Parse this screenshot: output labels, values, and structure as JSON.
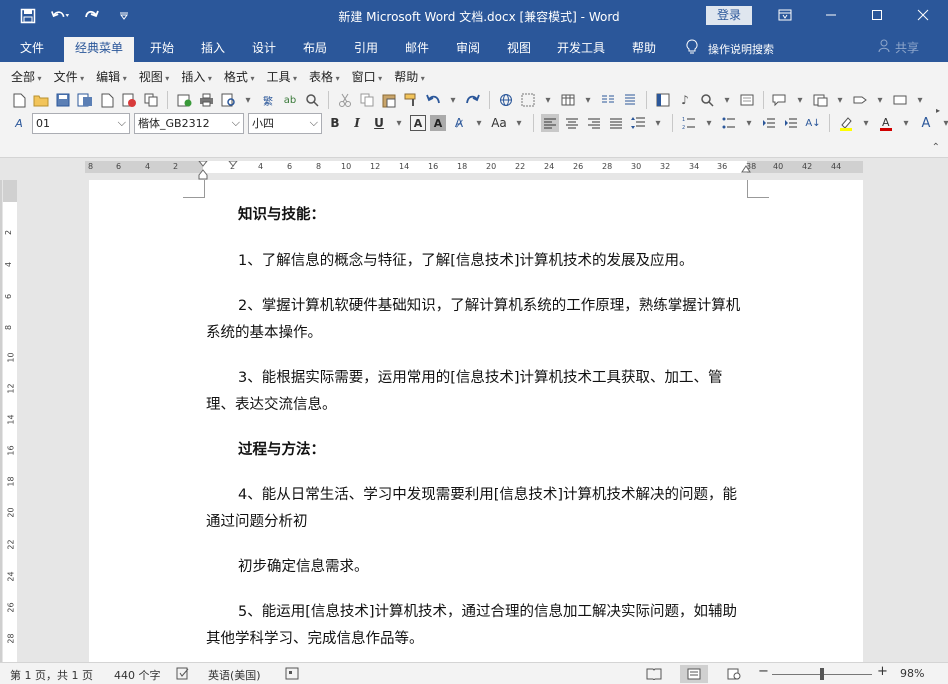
{
  "titlebar": {
    "title": "新建 Microsoft Word 文档.docx [兼容模式]  -  Word",
    "login": "登录",
    "qat_icons": [
      "save-icon",
      "undo-icon",
      "redo-icon",
      "customize-icon"
    ],
    "color": "#2b579a"
  },
  "tabs": [
    "文件",
    "经典菜单",
    "开始",
    "插入",
    "设计",
    "布局",
    "引用",
    "邮件",
    "审阅",
    "视图",
    "开发工具",
    "帮助"
  ],
  "active_tab": "经典菜单",
  "tellme": "操作说明搜索",
  "share": "共享",
  "menus": [
    "全部",
    "文件",
    "编辑",
    "视图",
    "插入",
    "格式",
    "工具",
    "表格",
    "窗口",
    "帮助"
  ],
  "format": {
    "style": "01",
    "font": "楷体_GB2312",
    "size": "小四",
    "bold": "B",
    "italic": "I",
    "underline": "U",
    "char_border": "A",
    "char_shading": "A",
    "case": "Aa"
  },
  "ruler": {
    "left_ticks": [
      "8",
      "6",
      "4",
      "2"
    ],
    "right_ticks": [
      "2",
      "4",
      "6",
      "8",
      "10",
      "12",
      "14",
      "16",
      "18",
      "20",
      "22",
      "24",
      "26",
      "28",
      "30",
      "32",
      "34",
      "36",
      "38",
      "40",
      "42",
      "44"
    ],
    "vertical_ticks": [
      "2",
      "4",
      "6",
      "8",
      "10",
      "12",
      "14",
      "16",
      "18",
      "20",
      "22",
      "24",
      "26",
      "28"
    ]
  },
  "document": {
    "heading1": "知识与技能：",
    "p1": "1、了解信息的概念与特征，了解[信息技术]计算机技术的发展及应用。",
    "p2": "2、掌握计算机软硬件基础知识，了解计算机系统的工作原理，熟练掌握计算机系统的基本操作。",
    "p3": "3、能根据实际需要，运用常用的[信息技术]计算机技术工具获取、加工、管理、表达交流信息。",
    "heading2": "过程与方法：",
    "p4": "4、能从日常生活、学习中发现需要利用[信息技术]计算机技术解决的问题，能通过问题分析初",
    "p5": "初步确定信息需求。",
    "p6": "5、能运用[信息技术]计算机技术，通过合理的信息加工解决实际问题，如辅助其他学科学习、完成信息作品等。"
  },
  "status": {
    "page": "第 1 页，共 1 页",
    "words": "440 个字",
    "language": "英语(美国)",
    "zoom": "98%"
  }
}
